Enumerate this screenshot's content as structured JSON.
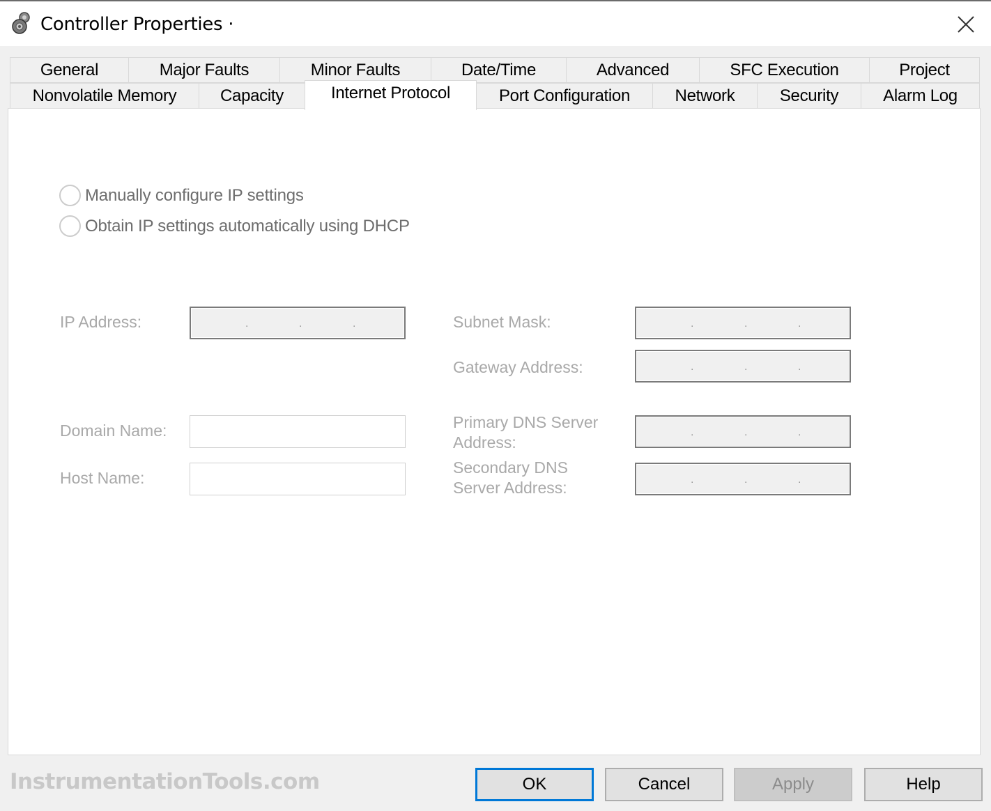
{
  "window": {
    "title": "Controller Properties ·",
    "icon": "controller-gear-icon",
    "close_icon": "close-icon"
  },
  "tabs": {
    "row1": [
      {
        "label": "General"
      },
      {
        "label": "Major Faults"
      },
      {
        "label": "Minor Faults"
      },
      {
        "label": "Date/Time"
      },
      {
        "label": "Advanced"
      },
      {
        "label": "SFC Execution"
      },
      {
        "label": "Project"
      }
    ],
    "row2": [
      {
        "label": "Nonvolatile Memory"
      },
      {
        "label": "Capacity"
      },
      {
        "label": "Internet Protocol"
      },
      {
        "label": "Port Configuration"
      },
      {
        "label": "Network"
      },
      {
        "label": "Security"
      },
      {
        "label": "Alarm Log"
      }
    ],
    "active": "Internet Protocol"
  },
  "ip_settings": {
    "options": [
      {
        "label": "Manually configure IP settings",
        "selected": false
      },
      {
        "label": "Obtain IP settings automatically using DHCP",
        "selected": false
      }
    ],
    "fields": {
      "ip_address": {
        "label": "IP Address:",
        "value": ". . ."
      },
      "subnet_mask": {
        "label": "Subnet Mask:",
        "value": ". . ."
      },
      "gateway_address": {
        "label": "Gateway Address:",
        "value": ". . ."
      },
      "domain_name": {
        "label": "Domain Name:",
        "value": ""
      },
      "host_name": {
        "label": "Host Name:",
        "value": ""
      },
      "primary_dns": {
        "label_line1": "Primary DNS Server",
        "label_line2": "Address:",
        "value": ". . ."
      },
      "secondary_dns": {
        "label_line1": "Secondary DNS",
        "label_line2": "Server Address:",
        "value": ". . ."
      }
    },
    "ip_separator": "."
  },
  "footer": {
    "watermark": "InstrumentationTools.com",
    "buttons": {
      "ok": "OK",
      "cancel": "Cancel",
      "apply": "Apply",
      "help": "Help"
    }
  },
  "colors": {
    "accent": "#0078d7",
    "disabled_text": "#a9a9a9"
  }
}
